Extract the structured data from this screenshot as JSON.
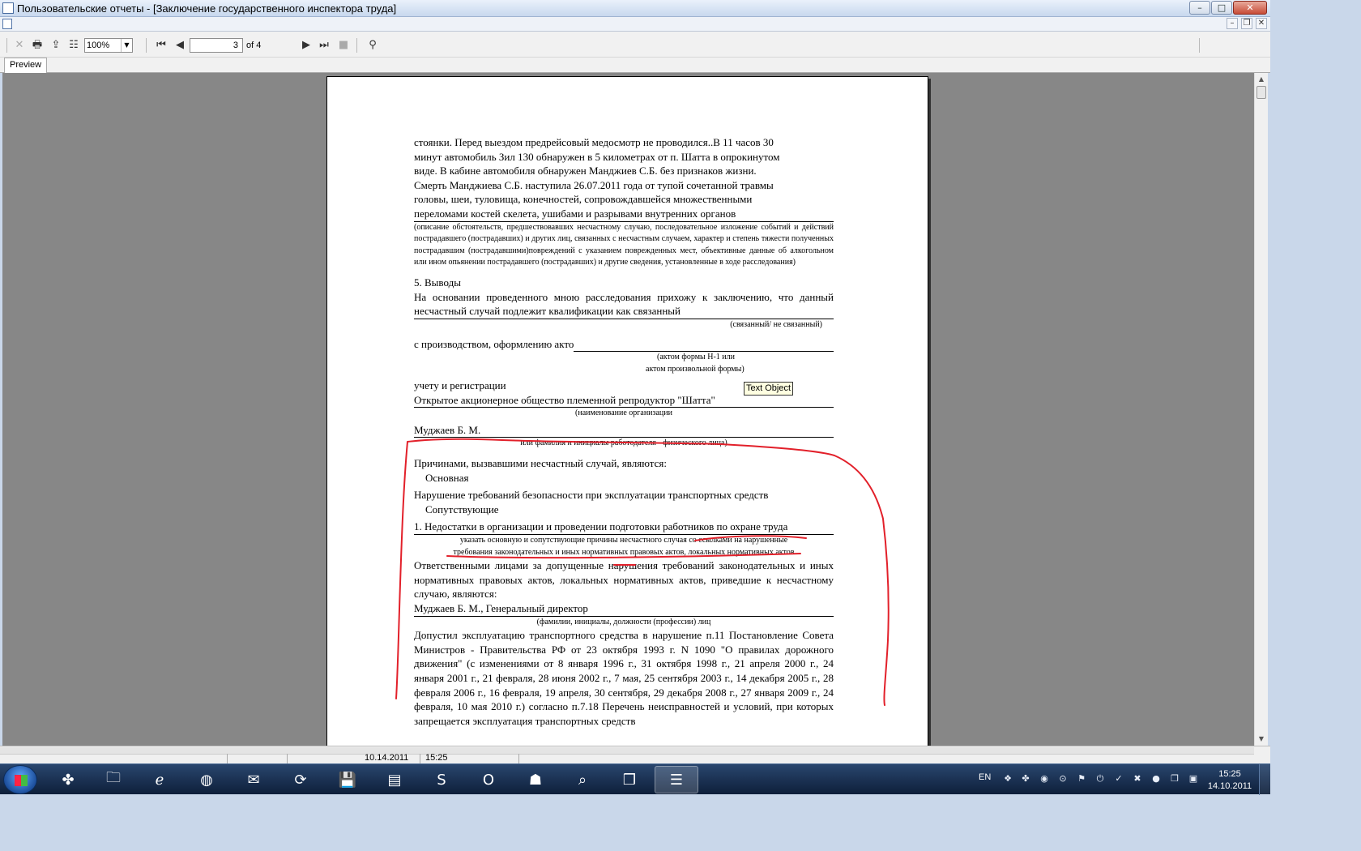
{
  "window": {
    "title": "Пользовательские отчеты - [Заключение государственного инспектора труда]",
    "buttons": {
      "minimize": "–",
      "maximize": "□",
      "close": "✕"
    }
  },
  "mdi": {
    "minimize": "–",
    "restore": "❐",
    "close": "✕"
  },
  "toolbar": {
    "zoom": "100%",
    "current_page": "3",
    "page_count": "of 4"
  },
  "tabs": {
    "preview": "Preview"
  },
  "document": {
    "para1": [
      "стоянки. Перед выездом предрейсовый медосмотр не проводился..В 11 часов 30",
      "минут автомобиль Зил 130 обнаружен в 5 километрах от п. Шатта в опрокинутом",
      "виде. В кабине автомобиля обнаружен Манджиев С.Б. без признаков жизни.",
      "Смерть Манджиева С.Б. наступила 26.07.2011 года от тупой сочетанной травмы",
      "головы, шеи, туловища, конечностей, сопровождавшейся множественными",
      "переломами костей скелета, ушибами и разрывами внутренних органов"
    ],
    "caption1": "(описание обстоятельств, предшествовавших несчастному случаю, последовательное изложение событий и действий пострадавшего (пострадавших) и других лиц, связанных с несчастным случаем, характер и степень тяжести полученных пострадавшим (пострадавшими)повреждений с указанием поврежденных мест, объективные данные об алкогольном или ином опьянении пострадавшего (пострадавших) и другие сведения, установленные в ходе расследования)",
    "section5_title": "5. Выводы",
    "conclusion": "На основании проведенного мною расследования прихожу к заключению, что данный несчастный случай подлежит квалификации как связанный",
    "caption_related": "(связанный/ не связанный)",
    "act_lead": "с производством, оформлению акто",
    "caption_act_1": "(актом формы Н-1 или",
    "caption_act_2": "актом произвольной формы)",
    "registration": "учету и регистрации",
    "organization": "Открытое акционерное общество племенной репродуктор \"Шатта\"",
    "caption_org": "(наименование организации",
    "employer": "Муджаев Б. М.",
    "caption_employer": "или фамилия и инициалы работодателя - физического лица)",
    "causes_title": "Причинами, вызвавшими несчастный случай, являются:",
    "main_label": "Основная",
    "main_cause": "Нарушение требований безопасности при эксплуатации транспортных средств",
    "related_label": "Сопутствующие",
    "related_cause": "1. Недостатки в организации и проведении подготовки работников по охране труда",
    "caption_causes": "указать основную и сопутствующие причины несчастного случая со ссылками на нарушенные требования законодательных и иных нормативных правовых актов, локальных нормативных актов",
    "responsible_text": "Ответственными лицами за допущенные нарушения требований законодательных и иных нормативных правовых актов, локальных нормативных актов, приведшие к несчастному случаю, являются:",
    "responsible_person": "Муджаев Б. М., Генеральный директор",
    "caption_persons": "(фамилии, инициалы, должности (профессии) лиц",
    "violation": "Допустил эксплуатацию транспортного средства в нарушение п.11 Постановление Совета Министров - Правительства РФ от 23 октября 1993 г. N 1090 \"О правилах дорожного движения\" (с изменениями от 8 января 1996 г., 31 октября 1998 г., 21 апреля 2000 г., 24 января 2001 г., 21 февраля, 28 июня 2002 г., 7 мая, 25 сентября 2003 г., 14 декабря 2005 г., 28 февраля 2006 г., 16 февраля, 19 апреля, 30 сентября, 29 декабря 2008 г., 27 января 2009 г., 24 февраля, 10 мая 2010 г.) согласно п.7.18 Перечень неисправностей и условий, при которых запрещается эксплуатация транспортных средств"
  },
  "tooltip": "Text Object",
  "status": {
    "date": "10.14.2011",
    "time": "15:25"
  },
  "taskbar": {
    "lang": "EN",
    "clock_time": "15:25",
    "clock_date": "14.10.2011"
  },
  "colors": {
    "annotation": "#e2202a",
    "viewer_bg": "#878787"
  }
}
